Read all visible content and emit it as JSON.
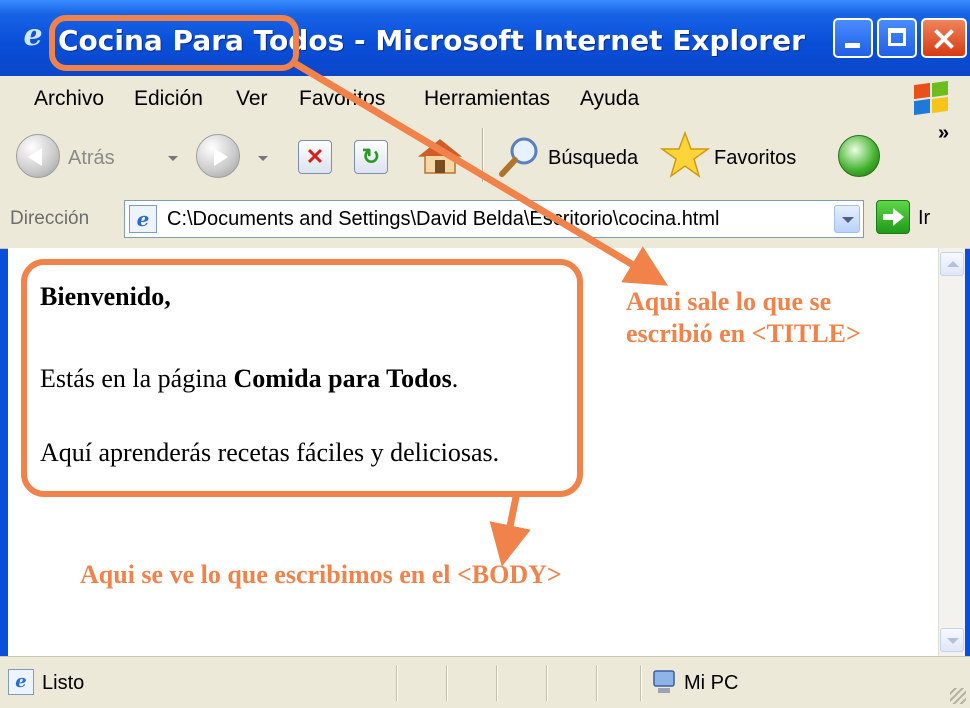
{
  "window": {
    "title_page": "Cocina Para Todos",
    "title_app": "Microsoft Internet Explorer"
  },
  "menu": {
    "items": [
      "Archivo",
      "Edición",
      "Ver",
      "Favoritos",
      "Herramientas",
      "Ayuda"
    ]
  },
  "toolbar": {
    "back_label": "Atrás",
    "search_label": "Búsqueda",
    "favorites_label": "Favoritos",
    "icons": [
      "back-arrow-icon",
      "forward-arrow-icon",
      "stop-icon",
      "refresh-icon",
      "home-icon",
      "search-icon",
      "favorites-star-icon",
      "history-icon"
    ]
  },
  "address": {
    "label": "Dirección",
    "url": "C:\\Documents and Settings\\David Belda\\Escritorio\\cocina.html",
    "go_label": "Ir"
  },
  "page": {
    "greeting": "Bienvenido,",
    "line2_prefix": "Estás en la página ",
    "line2_bold": "Comida para Todos",
    "line2_suffix": ".",
    "line3": "Aquí aprenderás recetas fáciles y deliciosas."
  },
  "annotations": {
    "title_note_line1": "Aqui sale lo que se",
    "title_note_line2": "escribió en <TITLE>",
    "body_note": "Aqui se ve lo que escribimos en el <BODY>",
    "color": "#f0824a"
  },
  "status": {
    "text": "Listo",
    "zone": "Mi PC"
  },
  "colors": {
    "titlebar": "#0a4fd9",
    "chrome": "#ece9d8",
    "annotation": "#f0824a"
  }
}
